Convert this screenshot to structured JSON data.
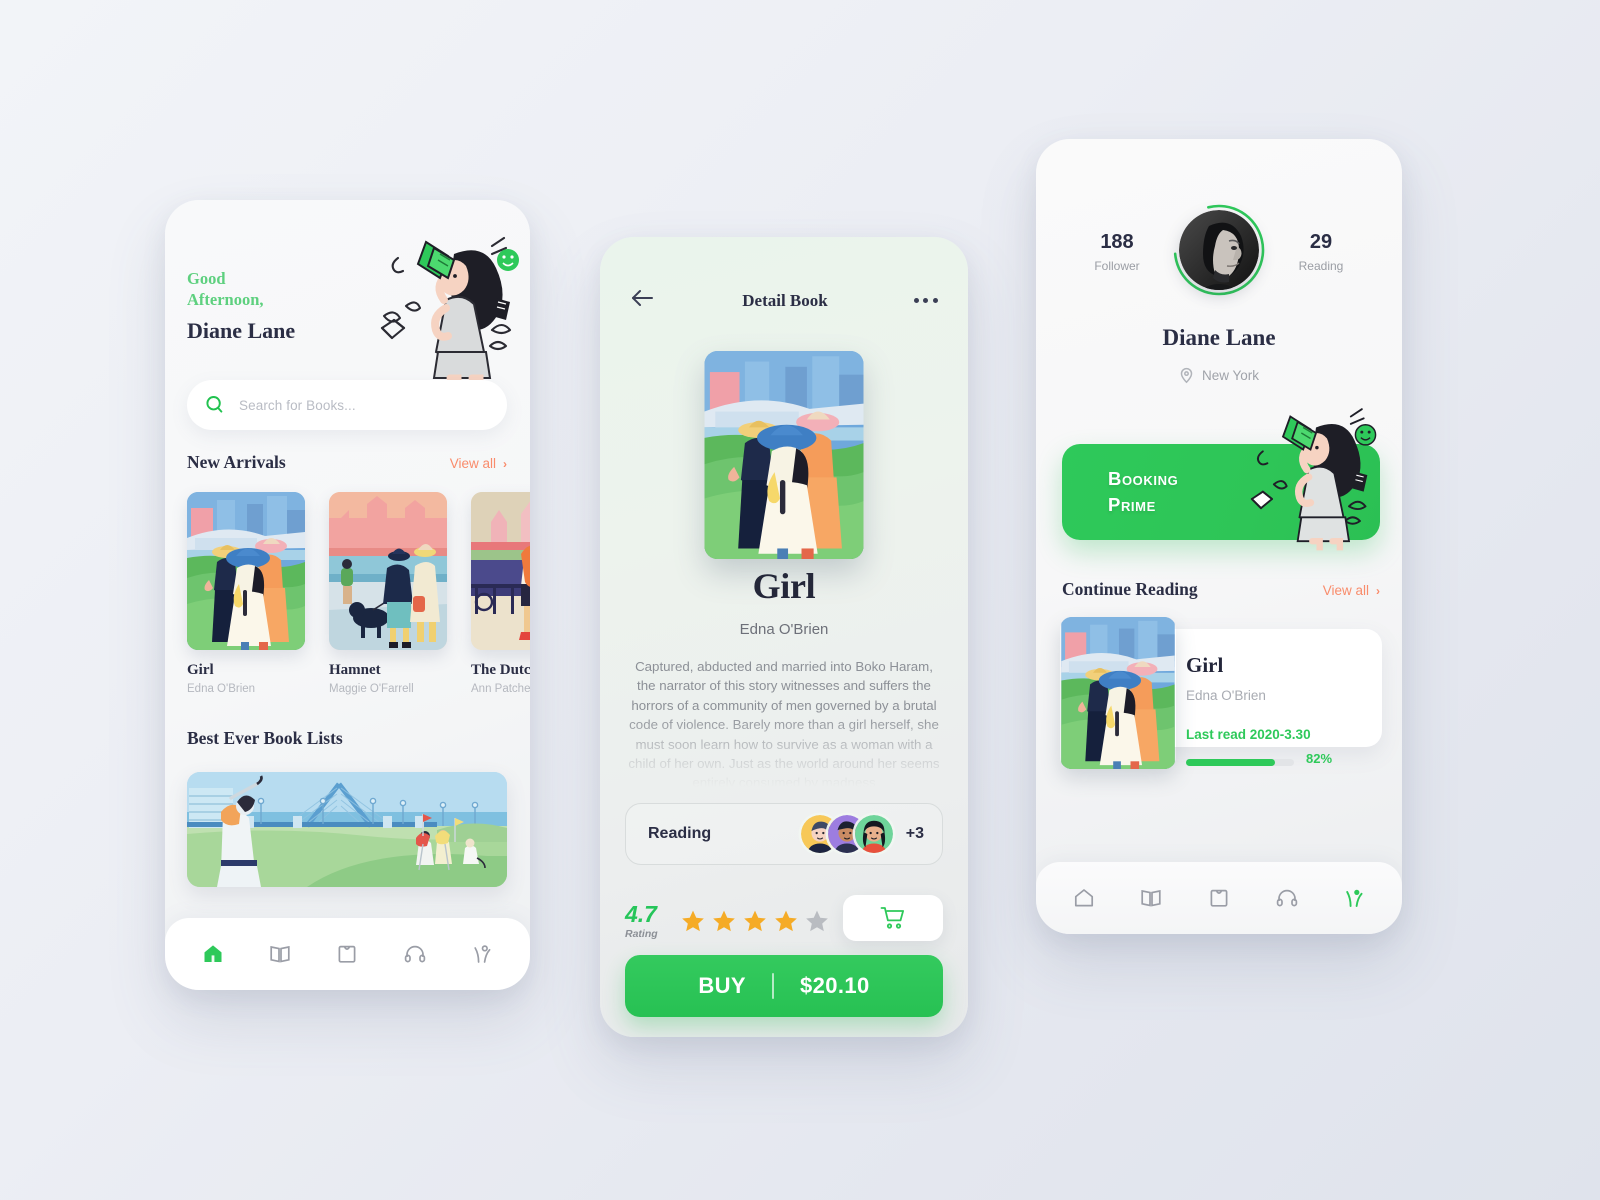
{
  "background": {
    "color": "#eef0f5"
  },
  "theme": {
    "green": "#2ec95a",
    "green_light": "#5ed07f",
    "coral": "#f98c6b",
    "ink": "#2b2e45",
    "muted": "#b5b8bf",
    "star_gold": "#f5ab26",
    "star_gray": "#b9bcc1"
  },
  "home": {
    "greeting_line1": "Good",
    "greeting_line2": "Afternoon,",
    "user_name": "Diane Lane",
    "search": {
      "placeholder": "Search for Books...",
      "icon": "search-icon"
    },
    "new_arrivals": {
      "title": "New Arrivals",
      "view_all": "View all",
      "chevron": "›"
    },
    "books": [
      {
        "title": "Girl",
        "author": "Edna O'Brien"
      },
      {
        "title": "Hamnet",
        "author": "Maggie O'Farrell"
      },
      {
        "title": "The Dutch",
        "author": "Ann Patchett"
      }
    ],
    "best_lists": {
      "title": "Best Ever Book Lists"
    },
    "nav": [
      {
        "name": "home",
        "icon": "home-icon",
        "active": true
      },
      {
        "name": "library",
        "icon": "book-icon",
        "active": false
      },
      {
        "name": "bag",
        "icon": "bag-icon",
        "active": false
      },
      {
        "name": "audio",
        "icon": "headphones-icon",
        "active": false
      },
      {
        "name": "profile",
        "icon": "person-icon",
        "active": false
      }
    ]
  },
  "detail": {
    "topbar": {
      "back": "back-arrow-icon",
      "title": "Detail Book",
      "more": "more-options-icon"
    },
    "book_title": "Girl",
    "book_author": "Edna O'Brien",
    "description": "Captured, abducted and married into Boko Haram, the narrator of this story witnesses and suffers the horrors of a community of men governed by a brutal code of violence. Barely more than a girl herself, she must soon learn how to survive as a woman with a child of her own. Just as the world around her seems entirely consumed by madness",
    "reading": {
      "label": "Reading",
      "extra_count": "+3",
      "avatar_count": 3
    },
    "rating": {
      "value": "4.7",
      "label": "Rating",
      "stars_filled": 4,
      "stars_total": 5
    },
    "cart": {
      "icon": "cart-icon"
    },
    "buy": {
      "label": "BUY",
      "price": "$20.10",
      "separator": "|"
    }
  },
  "profile": {
    "stats": [
      {
        "num": "188",
        "label": "Follower"
      },
      {
        "num": "29",
        "label": "Reading"
      }
    ],
    "name": "Diane Lane",
    "location": "New York",
    "location_icon": "pin-icon",
    "prime_banner": {
      "line1": "Booking",
      "line2": "Prime"
    },
    "continue_reading": {
      "title": "Continue Reading",
      "view_all": "View all",
      "chevron": "›"
    },
    "current_book": {
      "title": "Girl",
      "author": "Edna O'Brien",
      "last_read": "Last read 2020-3.30",
      "progress_pct": "82%",
      "progress_value": 82
    },
    "nav": [
      {
        "name": "home",
        "icon": "home-icon",
        "active": false
      },
      {
        "name": "library",
        "icon": "book-icon",
        "active": false
      },
      {
        "name": "bag",
        "icon": "bag-icon",
        "active": false
      },
      {
        "name": "audio",
        "icon": "headphones-icon",
        "active": false
      },
      {
        "name": "profile",
        "icon": "person-icon",
        "active": true
      }
    ]
  }
}
